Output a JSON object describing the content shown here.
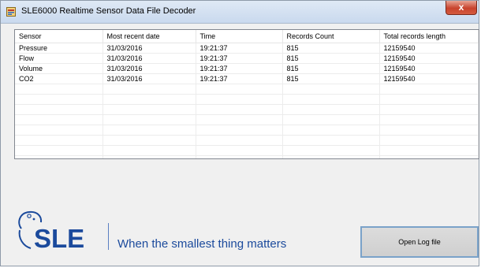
{
  "window": {
    "title": "SLE6000 Realtime Sensor Data File Decoder",
    "close_glyph": "x"
  },
  "grid": {
    "columns": [
      "Sensor",
      "Most recent date",
      "Time",
      "Records Count",
      "Total records length"
    ],
    "rows": [
      [
        "Pressure",
        "31/03/2016",
        "19:21:37",
        "815",
        "12159540"
      ],
      [
        "Flow",
        "31/03/2016",
        "19:21:37",
        "815",
        "12159540"
      ],
      [
        "Volume",
        "31/03/2016",
        "19:21:37",
        "815",
        "12159540"
      ],
      [
        "CO2",
        "31/03/2016",
        "19:21:37",
        "815",
        "12159540"
      ]
    ]
  },
  "branding": {
    "logo_text": "SLE",
    "tagline": "When the smallest thing matters",
    "brand_color": "#1b4a9c"
  },
  "actions": {
    "open_log_label": "Open Log file"
  }
}
